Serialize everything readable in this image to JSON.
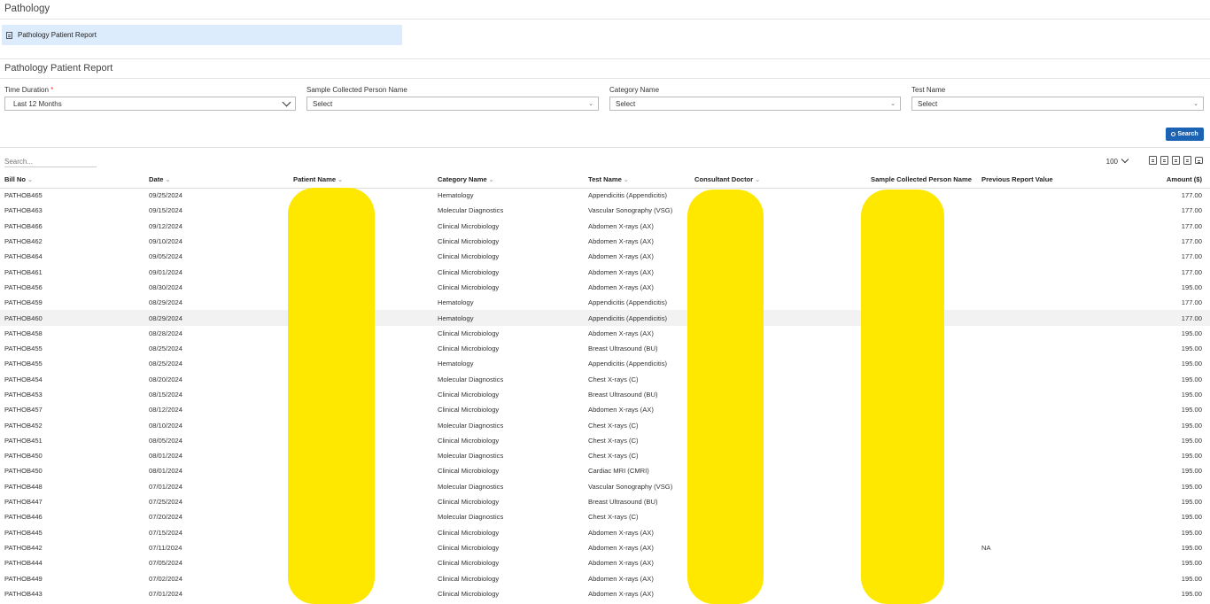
{
  "page_title": "Pathology",
  "breadcrumb": {
    "label": "Pathology Patient Report"
  },
  "report_title": "Pathology Patient Report",
  "filters": {
    "time_duration": {
      "label": "Time Duration",
      "required_mark": "*",
      "value": "Last 12 Months"
    },
    "sample_collected_person": {
      "label": "Sample Collected Person Name",
      "value": "Select"
    },
    "category_name": {
      "label": "Category Name",
      "value": "Select"
    },
    "test_name": {
      "label": "Test Name",
      "value": "Select"
    },
    "search_button": "Search"
  },
  "table_tools": {
    "search_placeholder": "Search...",
    "page_size": "100"
  },
  "table": {
    "columns": {
      "bill_no": "Bill No",
      "date": "Date",
      "patient_name": "Patient Name",
      "category_name": "Category Name",
      "test_name": "Test Name",
      "consultant_doctor": "Consultant Doctor",
      "sample_collected_person": "Sample Collected Person Name",
      "previous_report_value": "Previous Report Value",
      "amount": "Amount ($)"
    },
    "rows": [
      {
        "bill": "PATHOB465",
        "date": "09/25/2024",
        "category": "Hematology",
        "test": "Appendicitis (Appendicitis)",
        "prev": "",
        "amount": "177.00"
      },
      {
        "bill": "PATHOB463",
        "date": "09/15/2024",
        "category": "Molecular Diagnostics",
        "test": "Vascular Sonography (VSG)",
        "prev": "",
        "amount": "177.00"
      },
      {
        "bill": "PATHOB466",
        "date": "09/12/2024",
        "category": "Clinical Microbiology",
        "test": "Abdomen X-rays (AX)",
        "prev": "",
        "amount": "177.00"
      },
      {
        "bill": "PATHOB462",
        "date": "09/10/2024",
        "category": "Clinical Microbiology",
        "test": "Abdomen X-rays (AX)",
        "prev": "",
        "amount": "177.00"
      },
      {
        "bill": "PATHOB464",
        "date": "09/05/2024",
        "category": "Clinical Microbiology",
        "test": "Abdomen X-rays (AX)",
        "prev": "",
        "amount": "177.00"
      },
      {
        "bill": "PATHOB461",
        "date": "09/01/2024",
        "category": "Clinical Microbiology",
        "test": "Abdomen X-rays (AX)",
        "prev": "",
        "amount": "177.00"
      },
      {
        "bill": "PATHOB456",
        "date": "08/30/2024",
        "category": "Clinical Microbiology",
        "test": "Abdomen X-rays (AX)",
        "prev": "",
        "amount": "195.00"
      },
      {
        "bill": "PATHOB459",
        "date": "08/29/2024",
        "category": "Hematology",
        "test": "Appendicitis (Appendicitis)",
        "prev": "",
        "amount": "177.00"
      },
      {
        "bill": "PATHOB460",
        "date": "08/29/2024",
        "category": "Hematology",
        "test": "Appendicitis (Appendicitis)",
        "prev": "",
        "amount": "177.00"
      },
      {
        "bill": "PATHOB458",
        "date": "08/28/2024",
        "category": "Clinical Microbiology",
        "test": "Abdomen X-rays (AX)",
        "prev": "",
        "amount": "195.00"
      },
      {
        "bill": "PATHOB455",
        "date": "08/25/2024",
        "category": "Clinical Microbiology",
        "test": "Breast Ultrasound (BU)",
        "prev": "",
        "amount": "195.00"
      },
      {
        "bill": "PATHOB455",
        "date": "08/25/2024",
        "category": "Hematology",
        "test": "Appendicitis (Appendicitis)",
        "prev": "",
        "amount": "195.00"
      },
      {
        "bill": "PATHOB454",
        "date": "08/20/2024",
        "category": "Molecular Diagnostics",
        "test": "Chest X-rays (C)",
        "prev": "",
        "amount": "195.00"
      },
      {
        "bill": "PATHOB453",
        "date": "08/15/2024",
        "category": "Clinical Microbiology",
        "test": "Breast Ultrasound (BU)",
        "prev": "",
        "amount": "195.00"
      },
      {
        "bill": "PATHOB457",
        "date": "08/12/2024",
        "category": "Clinical Microbiology",
        "test": "Abdomen X-rays (AX)",
        "prev": "",
        "amount": "195.00"
      },
      {
        "bill": "PATHOB452",
        "date": "08/10/2024",
        "category": "Molecular Diagnostics",
        "test": "Chest X-rays (C)",
        "prev": "",
        "amount": "195.00"
      },
      {
        "bill": "PATHOB451",
        "date": "08/05/2024",
        "category": "Clinical Microbiology",
        "test": "Chest X-rays (C)",
        "prev": "",
        "amount": "195.00"
      },
      {
        "bill": "PATHOB450",
        "date": "08/01/2024",
        "category": "Molecular Diagnostics",
        "test": "Chest X-rays (C)",
        "prev": "",
        "amount": "195.00"
      },
      {
        "bill": "PATHOB450",
        "date": "08/01/2024",
        "category": "Clinical Microbiology",
        "test": "Cardiac MRI (CMRI)",
        "prev": "",
        "amount": "195.00"
      },
      {
        "bill": "PATHOB448",
        "date": "07/01/2024",
        "category": "Molecular Diagnostics",
        "test": "Vascular Sonography (VSG)",
        "prev": "",
        "amount": "195.00"
      },
      {
        "bill": "PATHOB447",
        "date": "07/25/2024",
        "category": "Clinical Microbiology",
        "test": "Breast Ultrasound (BU)",
        "prev": "",
        "amount": "195.00"
      },
      {
        "bill": "PATHOB446",
        "date": "07/20/2024",
        "category": "Molecular Diagnostics",
        "test": "Chest X-rays (C)",
        "prev": "",
        "amount": "195.00"
      },
      {
        "bill": "PATHOB445",
        "date": "07/15/2024",
        "category": "Clinical Microbiology",
        "test": "Abdomen X-rays (AX)",
        "prev": "",
        "amount": "195.00"
      },
      {
        "bill": "PATHOB442",
        "date": "07/11/2024",
        "category": "Clinical Microbiology",
        "test": "Abdomen X-rays (AX)",
        "prev": "NA",
        "amount": "195.00"
      },
      {
        "bill": "PATHOB444",
        "date": "07/05/2024",
        "category": "Clinical Microbiology",
        "test": "Abdomen X-rays (AX)",
        "prev": "",
        "amount": "195.00"
      },
      {
        "bill": "PATHOB449",
        "date": "07/02/2024",
        "category": "Clinical Microbiology",
        "test": "Abdomen X-rays (AX)",
        "prev": "",
        "amount": "195.00"
      },
      {
        "bill": "PATHOB443",
        "date": "07/01/2024",
        "category": "Clinical Microbiology",
        "test": "Abdomen X-rays (AX)",
        "prev": "",
        "amount": "195.00"
      }
    ]
  },
  "colors": {
    "accent": "#1d63b3",
    "breadcrumb_bg": "#dcecfc",
    "redaction": "#ffe800"
  }
}
